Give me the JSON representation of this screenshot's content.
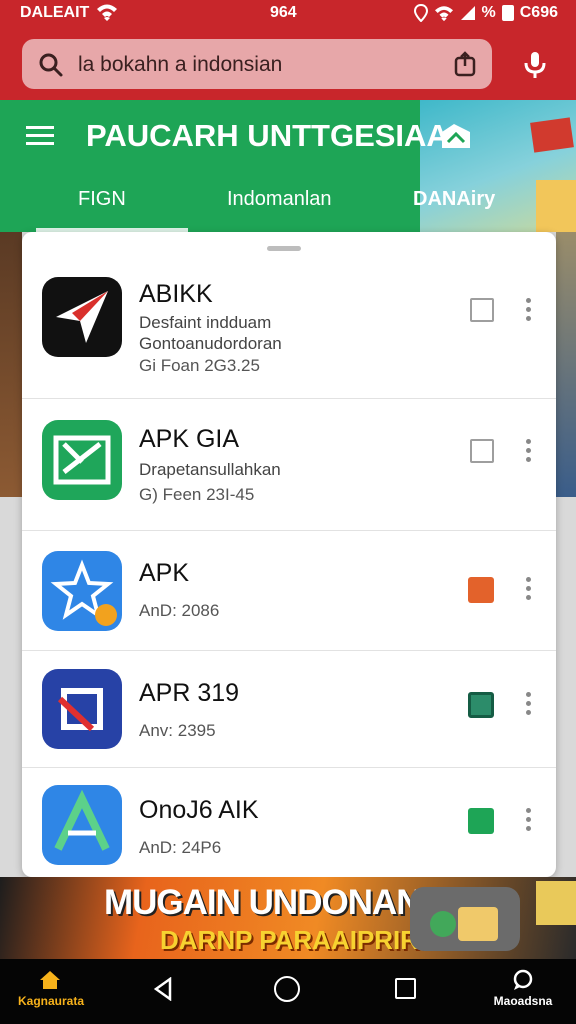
{
  "status_bar": {
    "carrier": "DALEAIT",
    "clock": "964",
    "percent_sign": "%",
    "battery": "C696"
  },
  "search": {
    "query": "la bokahn a indonsian",
    "icon": "search-icon",
    "share_icon": "share-icon",
    "mic_icon": "mic-icon"
  },
  "header": {
    "title": "PAUCARH UNTTGESIAA",
    "tabs": [
      {
        "label": "FIGN"
      },
      {
        "label": "Indomanlan"
      },
      {
        "label": "DANAiry"
      }
    ],
    "colors": {
      "top": "#c8262b",
      "green": "#1ea556"
    }
  },
  "apps": [
    {
      "name": "ABIKK",
      "desc": "Desfaint indduam\nGontoanudordoran",
      "meta": "Gi Foan 2G3.25",
      "action": "checkbox",
      "icon_color": "#111111"
    },
    {
      "name": "APK GIA",
      "desc": "Drapetansullahkan",
      "meta": "G) Feen 23I-45",
      "action": "checkbox",
      "icon_color": "#1fa65a"
    },
    {
      "name": "APK",
      "desc": "",
      "meta": "AnD: 2086",
      "action": "orange-badge",
      "icon_color": "#2f86e6"
    },
    {
      "name": "APR 319",
      "desc": "",
      "meta": "Anv: 2395",
      "action": "teal-badge",
      "icon_color": "#2742a6"
    },
    {
      "name": "OnoJ6 AIK",
      "desc": "",
      "meta": "AnD: 24P6",
      "action": "green-badge",
      "icon_color": "#2f86e6"
    }
  ],
  "banner": {
    "line1": "MUGAIN UNDONAN",
    "line2": "DARNP PARAAIPRIRI"
  },
  "navbar": {
    "home_label": "Kagnaurata",
    "chat_label": "Maoadsna"
  }
}
